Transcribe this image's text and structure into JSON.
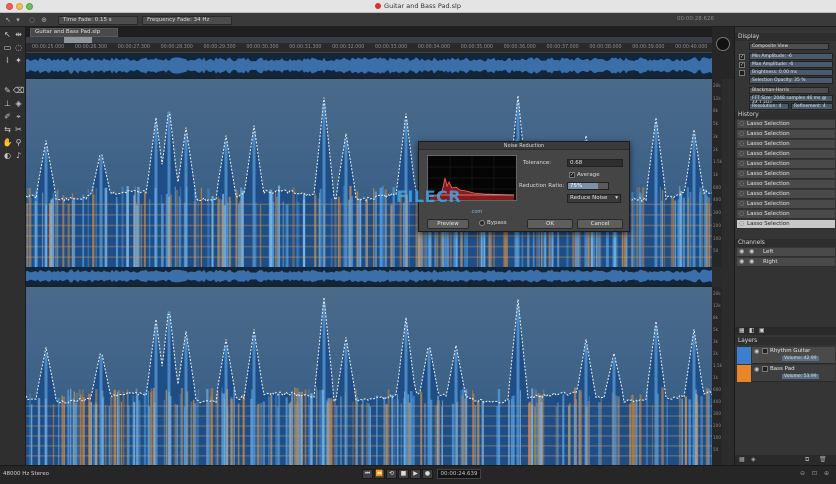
{
  "window": {
    "title": "Guitar and Bass Pad.slp"
  },
  "options_bar": {
    "time_fade": "Time Fade: 0.15 s",
    "frequency_fade": "Frequency Fade: 34 Hz",
    "timecode": "00:00:28.626"
  },
  "document": {
    "tab_label": "Guitar and Bass Pad.slp",
    "ruler_ticks": [
      "00:00:25.000",
      "00:00:26.300",
      "00:00:27.300",
      "00:00:28.300",
      "00:00:29.300",
      "00:00:30.300",
      "00:00:31.300",
      "00:00:32.000",
      "00:00:33.000",
      "00:00:34.000",
      "00:00:35.000",
      "00:00:36.000",
      "00:00:37.000",
      "00:00:38.000",
      "00:00:39.000",
      "00:00:40.000"
    ],
    "freq_labels_top": [
      "20k",
      "12k",
      "8k",
      "5k",
      "3k",
      "2k",
      "1.5k",
      "1k",
      "600",
      "400",
      "300",
      "200",
      "100",
      "50"
    ],
    "freq_labels_bottom": [
      "20k",
      "12k",
      "8k",
      "5k",
      "3k",
      "2k",
      "1.5k",
      "1k",
      "600",
      "400",
      "300",
      "200",
      "100",
      "50"
    ]
  },
  "noise_dialog": {
    "title": "Noise Reduction",
    "tolerance_label": "Tolerance:",
    "tolerance_value": "0.68",
    "average_label": "Average",
    "average_checked": true,
    "reduction_ratio_label": "Reduction Ratio:",
    "reduction_ratio_value": "75%",
    "reduction_ratio_fill": 0.75,
    "mode_select": "Reduce Noise",
    "preview_label": "Preview",
    "bypass_label": "Bypass",
    "ok_label": "OK",
    "cancel_label": "Cancel"
  },
  "watermark": {
    "text": "FILECR",
    "sub": ".com"
  },
  "right_panel": {
    "display": {
      "header": "Display",
      "composite_label": "Composite View",
      "rows": [
        "Min Amplitude: -6",
        "Max Amplitude: -6",
        "Brightness: 0.00 ms",
        "Selection Opacity: 35 %"
      ],
      "window_label": "Blackman-Harris",
      "fft_label": "FFT Size: 2048 samples",
      "fft_value": "46 ms @ 44.1 kHz",
      "resolution_label": "Resolution: 4",
      "refinement_label": "Refinement: 4"
    },
    "history": {
      "header": "History",
      "items": [
        "Lasso Selection",
        "Lasso Selection",
        "Lasso Selection",
        "Lasso Selection",
        "Lasso Selection",
        "Lasso Selection",
        "Lasso Selection",
        "Lasso Selection",
        "Lasso Selection",
        "Lasso Selection",
        "Lasso Selection"
      ],
      "selected_index": 10
    },
    "channels": {
      "header": "Channels",
      "items": [
        "Left",
        "Right"
      ]
    },
    "layers": {
      "header": "Layers",
      "items": [
        {
          "name": "Rhythm Guitar",
          "volume": "Volume: 42.99",
          "color": "#3a7fd0"
        },
        {
          "name": "Bass Pad",
          "volume": "Volume: 53.99",
          "color": "#e8872a"
        }
      ]
    }
  },
  "status_bar": {
    "format": "48000 Hz Stereo",
    "timecode": "00:00:24.639"
  },
  "colors": {
    "spectrogram_blue": "#1e5a9a",
    "spectrogram_orange": "#d98a3a",
    "selection_highlight": "#3a7fd0"
  }
}
